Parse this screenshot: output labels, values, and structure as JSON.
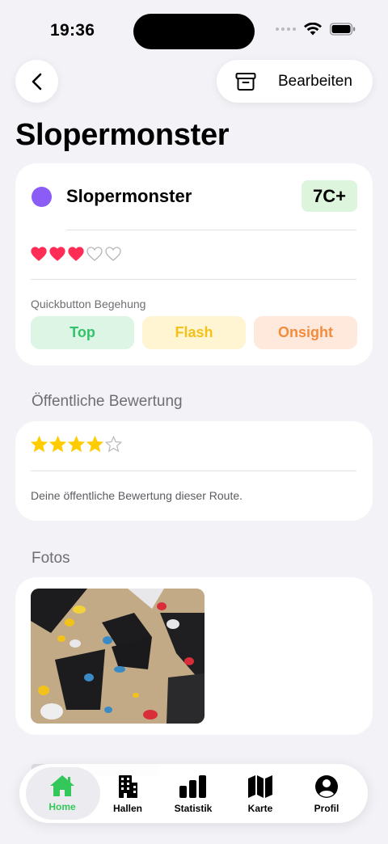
{
  "status_bar": {
    "time": "19:36"
  },
  "nav": {
    "edit_label": "Bearbeiten"
  },
  "page_title": "Slopermonster",
  "route": {
    "name": "Slopermonster",
    "color": "#8b5cf6",
    "grade": "7C+",
    "hearts_filled": 3,
    "hearts_total": 5
  },
  "quickbutton": {
    "label": "Quickbutton Begehung",
    "buttons": [
      "Top",
      "Flash",
      "Onsight"
    ]
  },
  "public_rating": {
    "header": "Öffentliche Bewertung",
    "stars_filled": 4,
    "stars_total": 5,
    "caption": "Deine öffentliche Bewertung dieser Route."
  },
  "photos": {
    "header": "Fotos",
    "count": 1
  },
  "tabs": [
    {
      "label": "Home",
      "icon": "house-icon",
      "active": true
    },
    {
      "label": "Hallen",
      "icon": "building-icon",
      "active": false
    },
    {
      "label": "Statistik",
      "icon": "chart-icon",
      "active": false
    },
    {
      "label": "Karte",
      "icon": "map-icon",
      "active": false
    },
    {
      "label": "Profil",
      "icon": "person-icon",
      "active": false
    }
  ],
  "colors": {
    "accent_green": "#34c759",
    "heart_red": "#ff2d55",
    "star_yellow": "#ffcc00"
  }
}
